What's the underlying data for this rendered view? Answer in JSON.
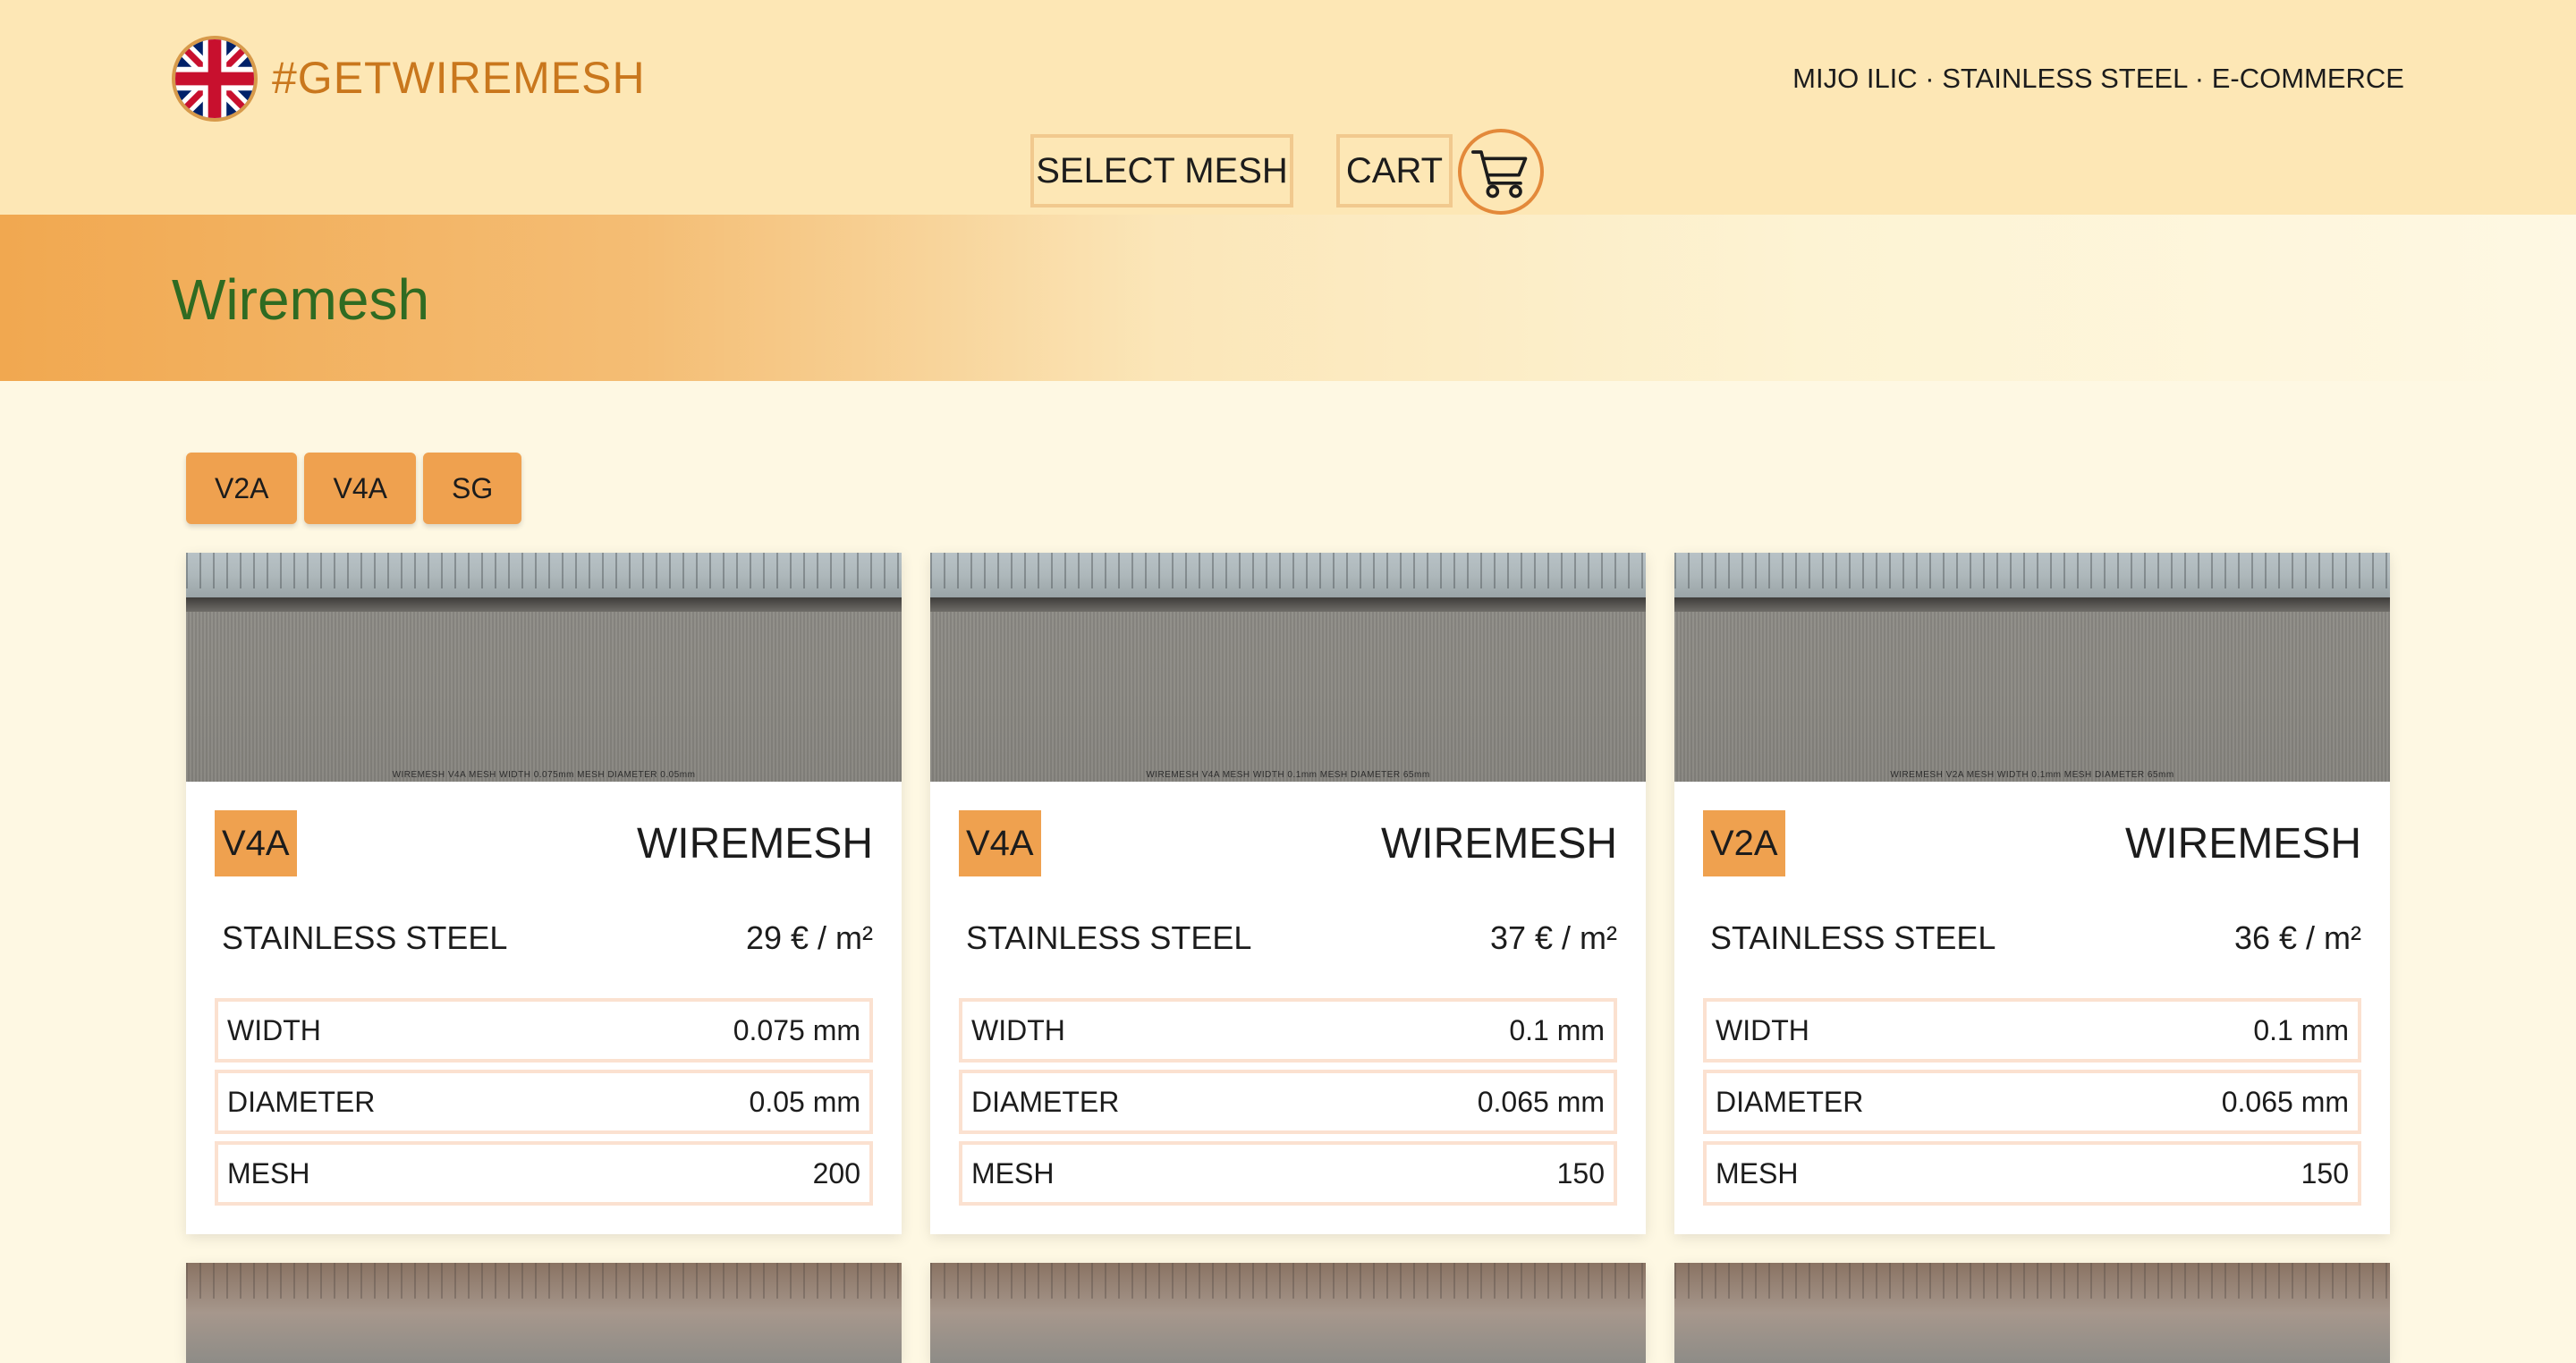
{
  "header": {
    "brand": "#GETWIREMESH",
    "tagline": "MIJO ILIC · STAINLESS STEEL · E-COMMERCE",
    "nav": {
      "select_mesh": "SELECT MESH",
      "cart": "CART"
    },
    "icons": {
      "flag": "uk-flag-icon",
      "cart": "shopping-cart-icon"
    }
  },
  "hero": {
    "title": "Wiremesh"
  },
  "filters": [
    "V2A",
    "V4A",
    "SG"
  ],
  "colors": {
    "accent": "#efa14f",
    "brand_text": "#c9771d",
    "hero_title": "#2f6b22",
    "header_bg": "#fde7b5",
    "page_bg": "#fef8e3"
  },
  "products": [
    {
      "image_caption": "WIREMESH V4A MESH WIDTH 0.075mm MESH DIAMETER 0.05mm",
      "grade": "V4A",
      "kind": "WIREMESH",
      "material": "STAINLESS STEEL",
      "price": "29 € / m²",
      "specs": [
        {
          "label": "WIDTH",
          "value": "0.075 mm"
        },
        {
          "label": "DIAMETER",
          "value": "0.05 mm"
        },
        {
          "label": "MESH",
          "value": "200"
        }
      ]
    },
    {
      "image_caption": "WIREMESH V4A MESH WIDTH 0.1mm MESH DIAMETER 65mm",
      "grade": "V4A",
      "kind": "WIREMESH",
      "material": "STAINLESS STEEL",
      "price": "37 € / m²",
      "specs": [
        {
          "label": "WIDTH",
          "value": "0.1 mm"
        },
        {
          "label": "DIAMETER",
          "value": "0.065 mm"
        },
        {
          "label": "MESH",
          "value": "150"
        }
      ]
    },
    {
      "image_caption": "WIREMESH V2A MESH WIDTH 0.1mm MESH DIAMETER 65mm",
      "grade": "V2A",
      "kind": "WIREMESH",
      "material": "STAINLESS STEEL",
      "price": "36 € / m²",
      "specs": [
        {
          "label": "WIDTH",
          "value": "0.1 mm"
        },
        {
          "label": "DIAMETER",
          "value": "0.065 mm"
        },
        {
          "label": "MESH",
          "value": "150"
        }
      ]
    }
  ]
}
